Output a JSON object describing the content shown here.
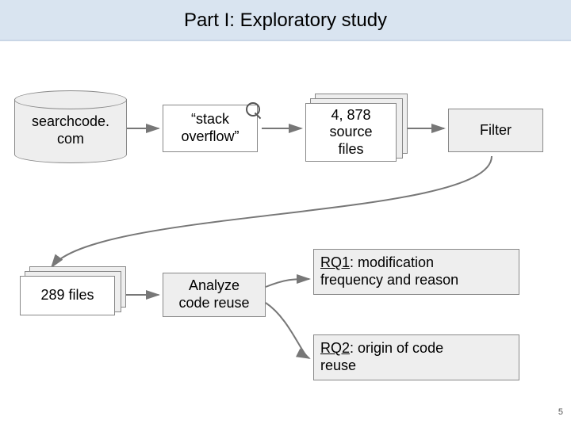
{
  "title": "Part I: Exploratory study",
  "db": {
    "label": "searchcode.\ncom"
  },
  "search": {
    "label": "“stack\noverflow”"
  },
  "sourcefiles": {
    "label": "4, 878\nsource\nfiles"
  },
  "filter": {
    "label": "Filter"
  },
  "files289": {
    "label": "289 files"
  },
  "analyze": {
    "label": "Analyze\ncode reuse"
  },
  "rq1": {
    "label": "RQ1: modification\nfrequency and reason"
  },
  "rq2": {
    "label": "RQ2: origin of code\nreuse"
  },
  "page": "5"
}
